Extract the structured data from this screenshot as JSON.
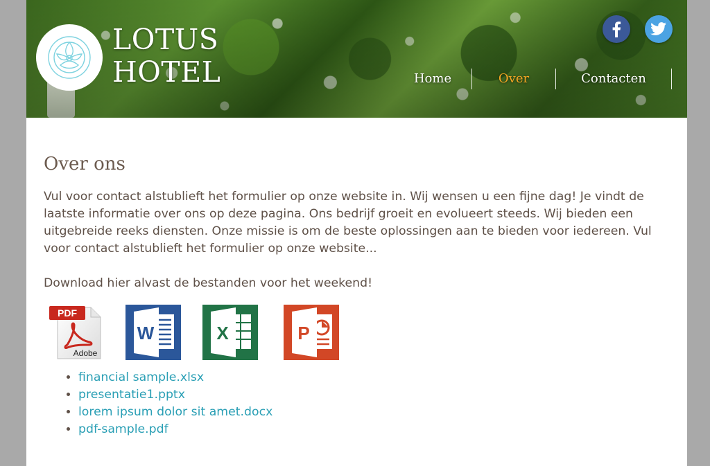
{
  "brand": {
    "line1": "LOTUS",
    "line2": "HOTEL"
  },
  "social": {
    "facebook_icon": "facebook-icon",
    "twitter_icon": "twitter-icon"
  },
  "nav": {
    "items": [
      {
        "label": "Home"
      },
      {
        "label": "Over"
      },
      {
        "label": "Contacten"
      }
    ],
    "active_index": 1,
    "active_color": "#f6a623"
  },
  "main": {
    "title": "Over ons",
    "intro": "Vul voor contact alstublieft het formulier op onze website in. Wij wensen u een fijne dag! Je vindt de laatste informatie over ons op deze pagina. Ons bedrijf groeit en evolueert steeds. Wij bieden een uitgebreide reeks diensten. Onze missie is om de beste oplossingen aan te bieden voor iedereen. Vul voor contact alstublieft het formulier op onze website...",
    "download_text": "Download hier alvast de bestanden voor het weekend!",
    "icons": [
      {
        "name": "pdf-icon",
        "badge": "PDF",
        "caption": "Adobe"
      },
      {
        "name": "word-icon",
        "letter": "W"
      },
      {
        "name": "excel-icon",
        "letter": "X"
      },
      {
        "name": "powerpoint-icon",
        "letter": "P"
      }
    ],
    "files": [
      "financial sample.xlsx",
      "presentatie1.pptx",
      "lorem ipsum dolor sit amet.docx",
      "pdf-sample.pdf"
    ]
  },
  "colors": {
    "link": "#2a9fb5",
    "text": "#5f5148",
    "heading": "#6b5a4e",
    "backdrop": "#a9a9a9"
  }
}
